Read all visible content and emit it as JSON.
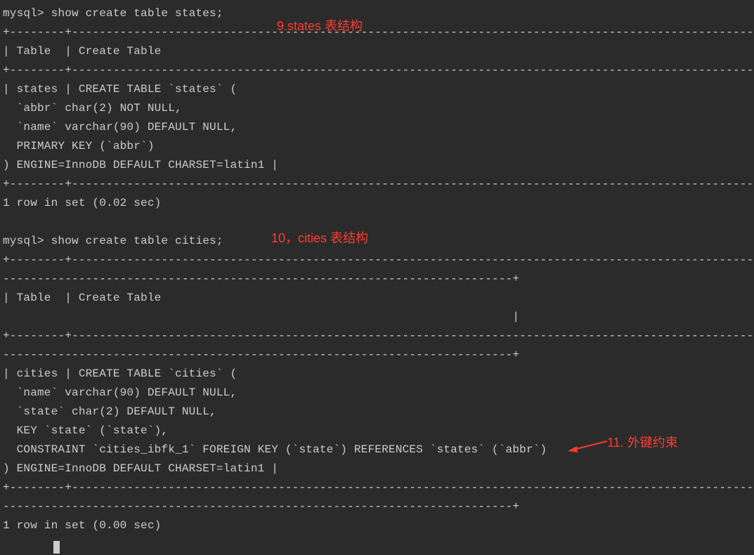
{
  "terminal": {
    "lines": [
      "mysql> show create table states;",
      "+--------+----------------------------------------------------------------------------------------------------------------------------+",
      "| Table  | Create Table                                                                                                               |",
      "+--------+----------------------------------------------------------------------------------------------------------------------------+",
      "| states | CREATE TABLE `states` (",
      "  `abbr` char(2) NOT NULL,",
      "  `name` varchar(90) DEFAULT NULL,",
      "  PRIMARY KEY (`abbr`)",
      ") ENGINE=InnoDB DEFAULT CHARSET=latin1 |",
      "+--------+----------------------------------------------------------------------------------------------------------------------------+",
      "1 row in set (0.02 sec)",
      "",
      "mysql> show create table cities;",
      "+--------+----------------------------------------------------------------------------------------------------------------------------",
      "--------------------------------------------------------------------------+",
      "| Table  | Create Table",
      "                                                                          |",
      "+--------+----------------------------------------------------------------------------------------------------------------------------",
      "--------------------------------------------------------------------------+",
      "| cities | CREATE TABLE `cities` (",
      "  `name` varchar(90) DEFAULT NULL,",
      "  `state` char(2) DEFAULT NULL,",
      "  KEY `state` (`state`),",
      "  CONSTRAINT `cities_ibfk_1` FOREIGN KEY (`state`) REFERENCES `states` (`abbr`)",
      ") ENGINE=InnoDB DEFAULT CHARSET=latin1 |",
      "+--------+----------------------------------------------------------------------------------------------------------------------------",
      "--------------------------------------------------------------------------+",
      "1 row in set (0.00 sec)"
    ]
  },
  "annotations": {
    "a9": "9.states 表结构",
    "a10": "10，cities 表结构",
    "a11": "11. 外键约束"
  }
}
